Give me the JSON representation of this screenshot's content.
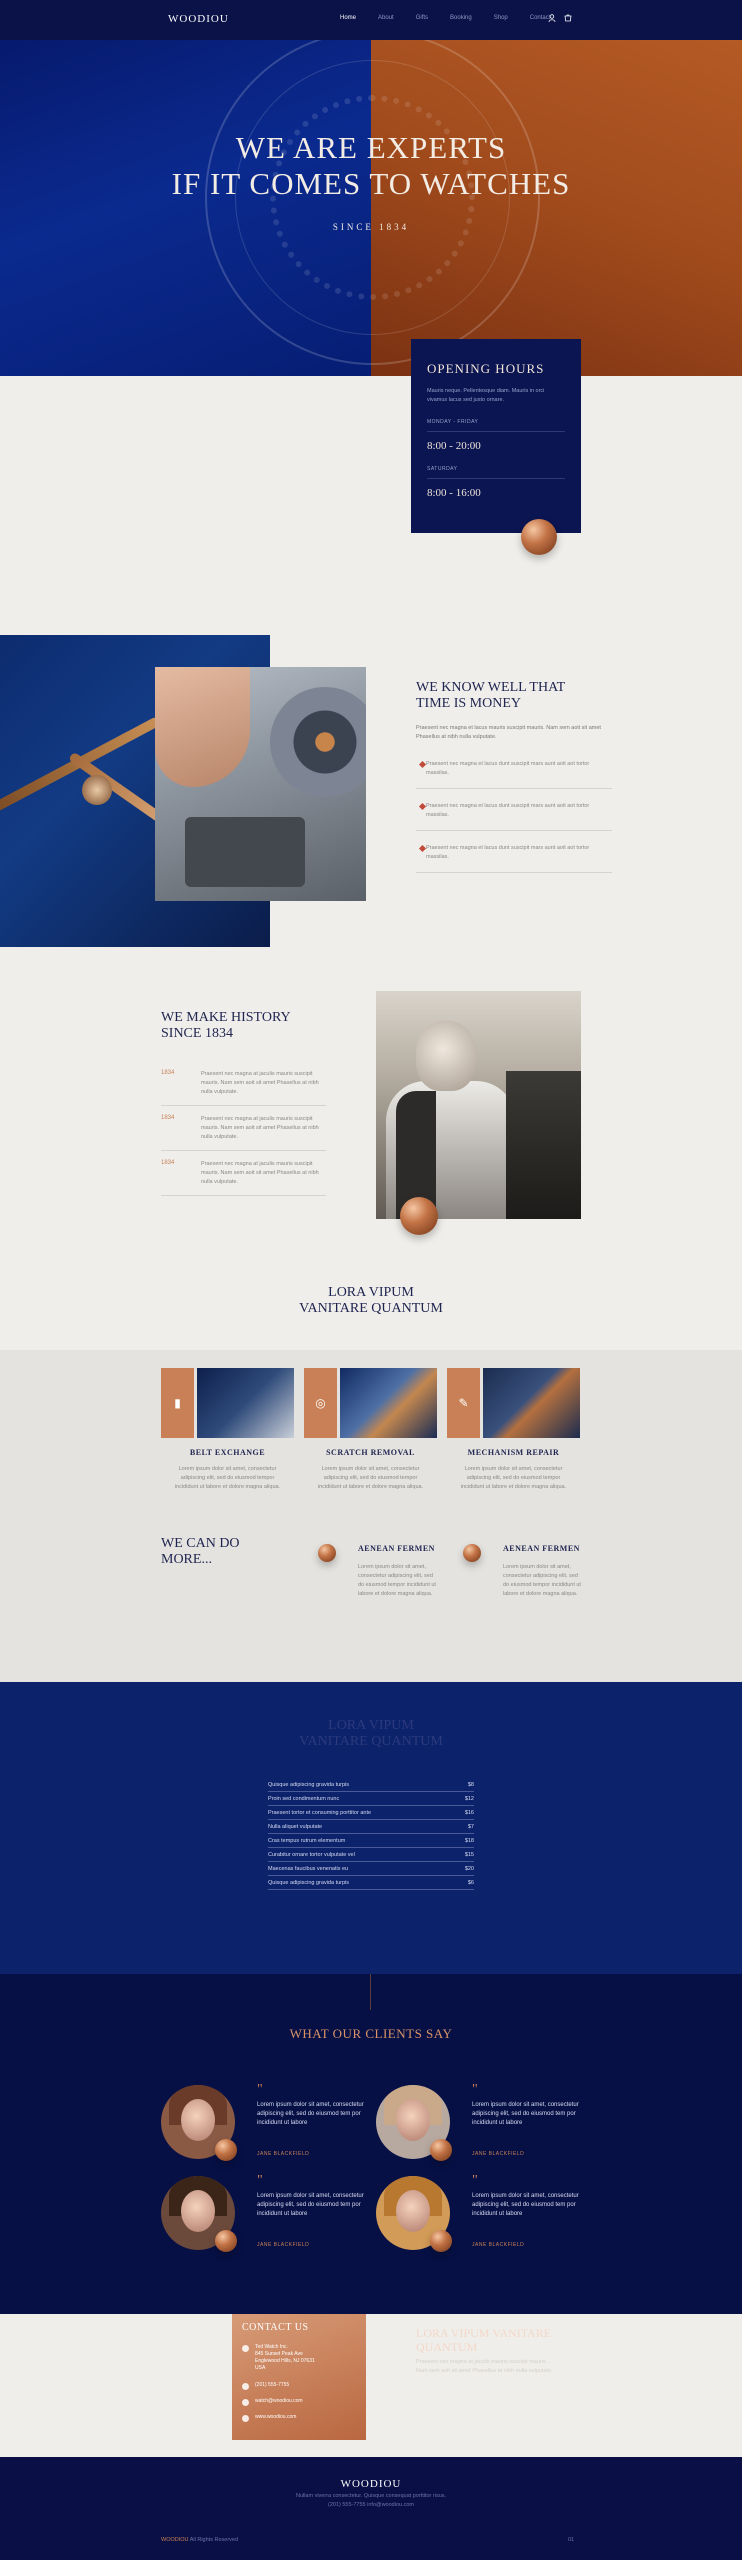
{
  "header": {
    "logo": "WOODIOU",
    "nav": [
      "Home",
      "About",
      "Gifts",
      "Booking",
      "Shop",
      "Contact"
    ],
    "active": "Home"
  },
  "hero": {
    "title_line1": "WE ARE EXPERTS",
    "title_line2": "IF IT COMES TO WATCHES",
    "since": "SINCE   1834"
  },
  "hours": {
    "title": "OPENING HOURS",
    "text": "Mauris neque. Pellentesque diam. Mauris in orci vivamus lacus sed justo ornare.",
    "label1": "MONDAY - FRIDAY",
    "time1": "8:00 - 20:00",
    "label2": "SATURDAY",
    "time2": "8:00 - 16:00"
  },
  "know": {
    "title": "WE KNOW WELL THAT TIME IS MONEY",
    "text": "Praesent nec magna et lacus mauris suscipit mauris. Nam sem aoit sit amet Phasellus at nibh nulla vulputate.",
    "items": [
      "Praesent nec magna et lacus dunt suscipit mars aunt aoit aot tortor massilas.",
      "Praesent nec magna et lacus dunt suscipit mars aunt aoit aot tortor massilas.",
      "Praesent nec magna et lacus dunt suscipit mars aunt aoit aot tortor massilas."
    ]
  },
  "history": {
    "title": "WE MAKE HISTORY SINCE 1834",
    "rows": [
      {
        "year": "1834",
        "text": "Praesent nec magna at jaculis mauris suscipit mauris. Nam sem aoit sit amet Phasellus at nibh nulla vulputate."
      },
      {
        "year": "1834",
        "text": "Praesent nec magna at jaculis mauris suscipit mauris. Nam sem aoit sit amet Phasellus at nibh nulla vulputate."
      },
      {
        "year": "1834",
        "text": "Praesent nec magna at jaculis mauris suscipit mauris. Nam sem aoit sit amet Phasellus at nibh nulla vulputate."
      }
    ]
  },
  "lora": {
    "line1": "LORA VIPUM",
    "line2": "VANITARE QUANTUM"
  },
  "services": [
    {
      "title": "BELT EXCHANGE",
      "text": "Lorem ipsum dolor sit amet, consectetur adipiscing elit, sed do eiusmod tempor incididunt ut labore et dolore magna aliqua."
    },
    {
      "title": "SCRATCH REMOVAL",
      "text": "Lorem ipsum dolor sit amet, consectetur adipiscing elit, sed do eiusmod tempor incididunt ut labore et dolore magna aliqua."
    },
    {
      "title": "MECHANISM REPAIR",
      "text": "Lorem ipsum dolor sit amet, consectetur adipiscing elit, sed do eiusmod tempor incididunt ut labore et dolore magna aliqua."
    }
  ],
  "more": {
    "title": "WE CAN DO MORE...",
    "features": [
      {
        "title": "AENEAN FERMEN",
        "text": "Lorem ipsum dolor sit amet, consectetur adipiscing elit, sed do eiusmod tempor incididunt ut labore et dolore magna aliqua."
      },
      {
        "title": "AENEAN FERMEN",
        "text": "Lorem ipsum dolor sit amet, consectetur adipiscing elit, sed do eiusmod tempor incididunt ut labore et dolore magna aliqua."
      }
    ]
  },
  "prices": {
    "title_line1": "LORA VIPUM",
    "title_line2": "VANITARE QUANTUM",
    "rows": [
      {
        "name": "Quisque adipiscing gravida turpis",
        "price": "$8"
      },
      {
        "name": "Proin sed condimentum nunc",
        "price": "$12"
      },
      {
        "name": "Praesent tortor et consuming porttitor ante",
        "price": "$16"
      },
      {
        "name": "Nulla aliquet vulputate",
        "price": "$7"
      },
      {
        "name": "Cras tempus rutrum elementum",
        "price": "$18"
      },
      {
        "name": "Curabitur ornare tortor vulputate vel",
        "price": "$15"
      },
      {
        "name": "Maecenas faucibus venenatis eu",
        "price": "$20"
      },
      {
        "name": "Quisque adipiscing gravida turpis",
        "price": "$6"
      }
    ]
  },
  "testimonials": {
    "title": "WHAT OUR CLIENTS SAY",
    "items": [
      {
        "text": "Lorem ipsum dolor sit amet, consectetur adipiscing elit, sed do eiusmod tem por incididunt ut labore",
        "name": "JANE BLACKFIELD"
      },
      {
        "text": "Lorem ipsum dolor sit amet, consectetur adipiscing elit, sed do eiusmod tem por incididunt ut labore",
        "name": "JANE BLACKFIELD"
      },
      {
        "text": "Lorem ipsum dolor sit amet, consectetur adipiscing elit, sed do eiusmod tem por incididunt ut labore",
        "name": "JANE BLACKFIELD"
      },
      {
        "text": "Lorem ipsum dolor sit amet, consectetur adipiscing elit, sed do eiusmod tem por incididunt ut labore",
        "name": "JANE BLACKFIELD"
      }
    ]
  },
  "contact": {
    "title": "CONTACT US",
    "address": "Ted Watch Inc.\n845 Sunset Peak Ave\nEnglewood Hills, NJ 07631\nUSA",
    "phone": "(201) 555-7755",
    "email": "watch@woodiou.com",
    "web": "www.woodiou.com",
    "side_title": "LORA VIPUM VANITARE QUANTUM",
    "side_text": "Praesent nec magna at jaculis mauris suscipit mauris. Nam sem aoit sit amet Phasellus at nibh nulla vulputate."
  },
  "footer": {
    "logo": "WOODIOU",
    "address": "Nullam viverra consectetur. Quisque consequat porttitor risus.\n(201) 555-7755 info@woodiou.com",
    "copy_brand": "WOODIOU",
    "copy_rest": " All Rights Reserved",
    "page": "01"
  },
  "colors": {
    "navy": "#0a1450",
    "copper": "#c98056",
    "cream": "#efeeea"
  }
}
